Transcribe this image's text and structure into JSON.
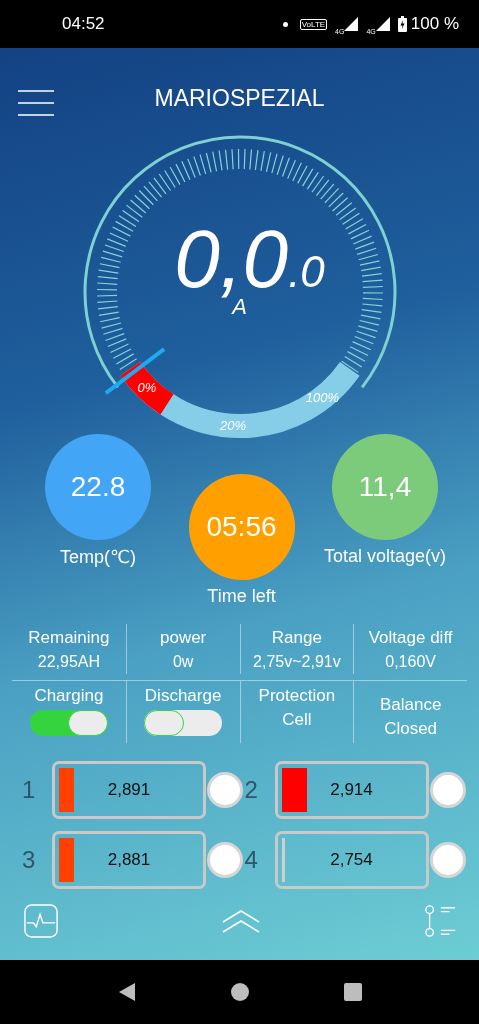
{
  "status_bar": {
    "time": "04:52",
    "volte": "VoLTE",
    "network_1": "4G",
    "network_2": "4G",
    "battery": "100 %"
  },
  "header": {
    "title": "MARIOSPEZIAL"
  },
  "gauge": {
    "value": "0,0",
    "decimal": ".0",
    "unit": "A",
    "scale_labels": [
      "0%",
      "20%",
      "100%"
    ]
  },
  "indicators": [
    {
      "kind": "temp",
      "value": "22.8",
      "label": "Temp(℃)",
      "color": "#42a5f5"
    },
    {
      "kind": "time",
      "value": "05:56",
      "label": "Time left",
      "color": "#ffa000"
    },
    {
      "kind": "voltage",
      "value": "11,4",
      "label": "Total voltage(v)",
      "color": "#7ccb7a"
    }
  ],
  "stats": [
    {
      "label": "Remaining",
      "value": "22,95AH"
    },
    {
      "label": "power",
      "value": "0w"
    },
    {
      "label": "Range",
      "value": "2,75v~2,91v"
    },
    {
      "label": "Voltage diff",
      "value": "0,160V"
    }
  ],
  "controls": [
    {
      "kind": "switch",
      "label": "Charging",
      "on": true
    },
    {
      "kind": "switch",
      "label": "Discharge",
      "on": false
    },
    {
      "kind": "text",
      "label": "Protection",
      "value": "Cell"
    },
    {
      "kind": "text",
      "label": "Balance",
      "value": "Closed"
    }
  ],
  "cells": [
    {
      "index": "1",
      "value": "2,891",
      "level": 0.1,
      "color": "#ff4000"
    },
    {
      "index": "2",
      "value": "2,914",
      "level": 0.17,
      "color": "#ff0000"
    },
    {
      "index": "3",
      "value": "2,881",
      "level": 0.1,
      "color": "#ff4000"
    },
    {
      "index": "4",
      "value": "2,754",
      "level": 0.02,
      "color": "#cfcfcf"
    }
  ]
}
